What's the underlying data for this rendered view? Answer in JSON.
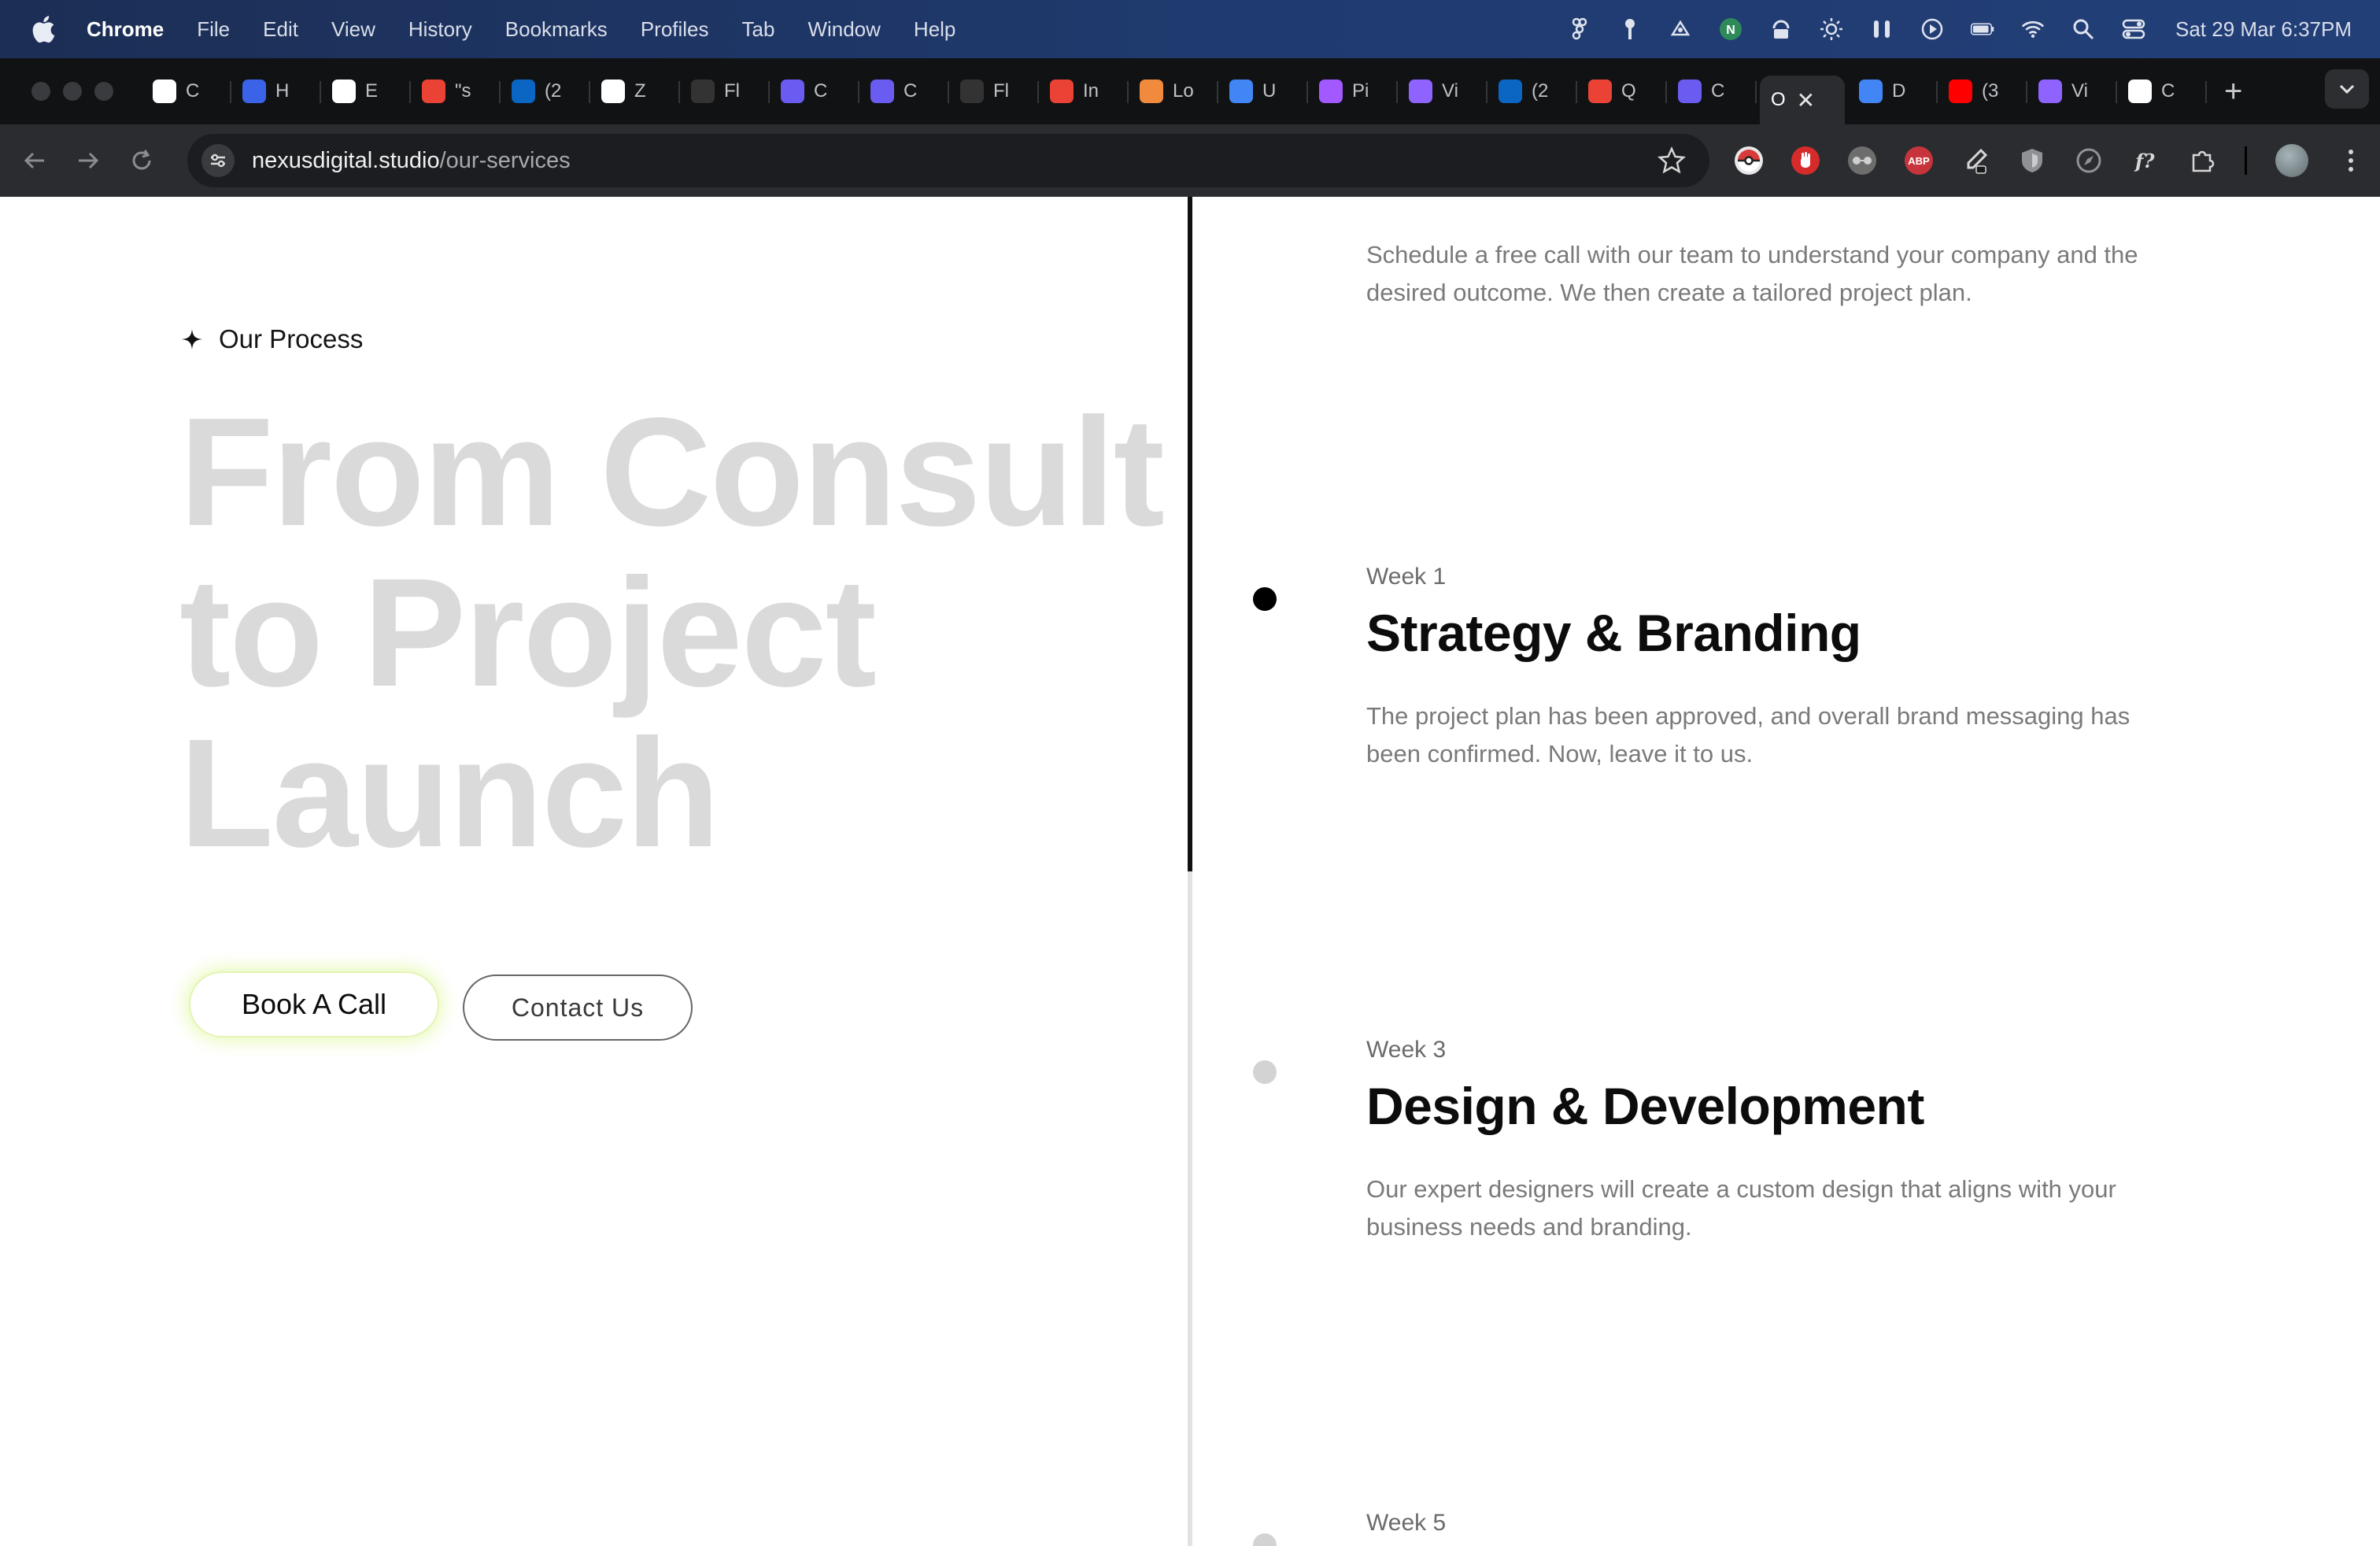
{
  "menubar": {
    "app": "Chrome",
    "items": [
      "File",
      "Edit",
      "View",
      "History",
      "Bookmarks",
      "Profiles",
      "Tab",
      "Window",
      "Help"
    ],
    "clock": "Sat 29 Mar  6:37PM"
  },
  "tabs": [
    {
      "label": "C",
      "icon": "openai-icon",
      "color": "#ffffff"
    },
    {
      "label": "H",
      "icon": "k-icon",
      "color": "#3b63e8"
    },
    {
      "label": "E",
      "icon": "grid-icon",
      "color": "#ffffff"
    },
    {
      "label": "\"s",
      "icon": "gmail-icon",
      "color": "#ea4335"
    },
    {
      "label": "(2",
      "icon": "linkedin-icon",
      "color": "#0a66c2"
    },
    {
      "label": "Z",
      "icon": "pen-icon",
      "color": "#ffffff"
    },
    {
      "label": "Fl",
      "icon": "fx-icon",
      "color": "#333333"
    },
    {
      "label": "C",
      "icon": "c-icon",
      "color": "#6a5cf0"
    },
    {
      "label": "C",
      "icon": "c-icon",
      "color": "#6a5cf0"
    },
    {
      "label": "Fl",
      "icon": "fx-icon",
      "color": "#333333"
    },
    {
      "label": "In",
      "icon": "gmail-icon",
      "color": "#ea4335"
    },
    {
      "label": "Lo",
      "icon": "heart-icon",
      "color": "#f08a3c"
    },
    {
      "label": "U",
      "icon": "docs-icon",
      "color": "#4285f4"
    },
    {
      "label": "Pi",
      "icon": "figma-icon",
      "color": "#a259ff"
    },
    {
      "label": "Vi",
      "icon": "vite-icon",
      "color": "#8e63ff"
    },
    {
      "label": "(2",
      "icon": "linkedin-icon",
      "color": "#0a66c2"
    },
    {
      "label": "Q",
      "icon": "gmail-icon",
      "color": "#ea4335"
    },
    {
      "label": "C",
      "icon": "c-icon",
      "color": "#6a5cf0"
    }
  ],
  "active_tab": {
    "label": "O"
  },
  "tabs_after": [
    {
      "label": "D",
      "icon": "calendar-icon",
      "color": "#4285f4"
    },
    {
      "label": "(3",
      "icon": "youtube-icon",
      "color": "#ff0000"
    },
    {
      "label": "Vi",
      "icon": "vite-icon",
      "color": "#8e63ff"
    },
    {
      "label": "C",
      "icon": "openai-icon",
      "color": "#ffffff"
    }
  ],
  "address": {
    "host": "nexusdigital.studio",
    "path": "/our-services"
  },
  "page": {
    "eyebrow": "Our Process",
    "hero_lines": [
      "From Consult",
      "to Project",
      "Launch"
    ],
    "book_call": "Book A Call",
    "contact": "Contact Us",
    "top_step_desc": "Schedule a free call with our team to understand your company and the desired outcome. We then create a tailored project plan.",
    "steps": [
      {
        "week": "Week 1",
        "title": "Strategy & Branding",
        "desc": "The project plan has been approved, and overall brand messaging has been confirmed. Now, leave it to us."
      },
      {
        "week": "Week 3",
        "title": "Design & Development",
        "desc": "Our expert designers will create a custom design that aligns with your business needs and branding."
      },
      {
        "week": "Week 5",
        "title": "",
        "desc": ""
      }
    ],
    "timeline_progress": 0.5
  }
}
